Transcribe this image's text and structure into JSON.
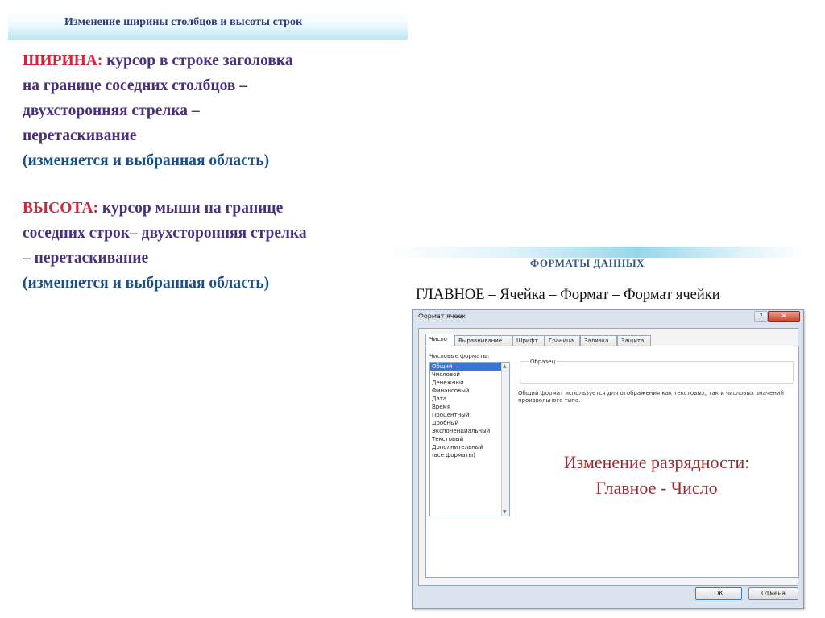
{
  "slide1": {
    "title": "Изменение ширины столбцов и высоты строк",
    "width_block": {
      "label": "ШИРИНА:",
      "line1": " курсор в строке заголовка",
      "line2": "на границе соседних столбцов –",
      "line3": "двухсторонняя стрелка –",
      "line4": "перетаскивание",
      "line5": "(изменяется и выбранная область)"
    },
    "height_block": {
      "label": "ВЫСОТА:",
      "line1": " курсор мыши на границе",
      "line2": "соседних строк– двухсторонняя стрелка",
      "line3": "– перетаскивание",
      "line4": "(изменяется и выбранная область)"
    }
  },
  "slide2": {
    "title": "ФОРМАТЫ ДАННЫХ",
    "subtitle": "ГЛАВНОЕ – Ячейка – Формат – Формат ячейки",
    "dialog": {
      "title": "Формат ячеек",
      "help": "?",
      "close": "✕",
      "tabs": [
        "Число",
        "Выравнивание",
        "Шрифт",
        "Граница",
        "Заливка",
        "Защита"
      ],
      "category_label": "Числовые форматы:",
      "categories": [
        "Общий",
        "Числовой",
        "Денежный",
        "Финансовый",
        "Дата",
        "Время",
        "Процентный",
        "Дробный",
        "Экспоненциальный",
        "Текстовый",
        "Дополнительный",
        "(все форматы)"
      ],
      "sample_label": "Образец",
      "description": "Общий формат используется для отображения как текстовых, так и числовых значений произвольного типа.",
      "overlay_line1": "Изменение разрядности:",
      "overlay_line2": "Главное - Число",
      "ok": "ОК",
      "cancel": "Отмена"
    }
  },
  "colors": {
    "accent_red": "#d5243a",
    "text_violet": "#4a2f7e",
    "text_blue": "#1c4f86",
    "overlay_red": "#9c2a33",
    "selection": "#3875d7"
  }
}
